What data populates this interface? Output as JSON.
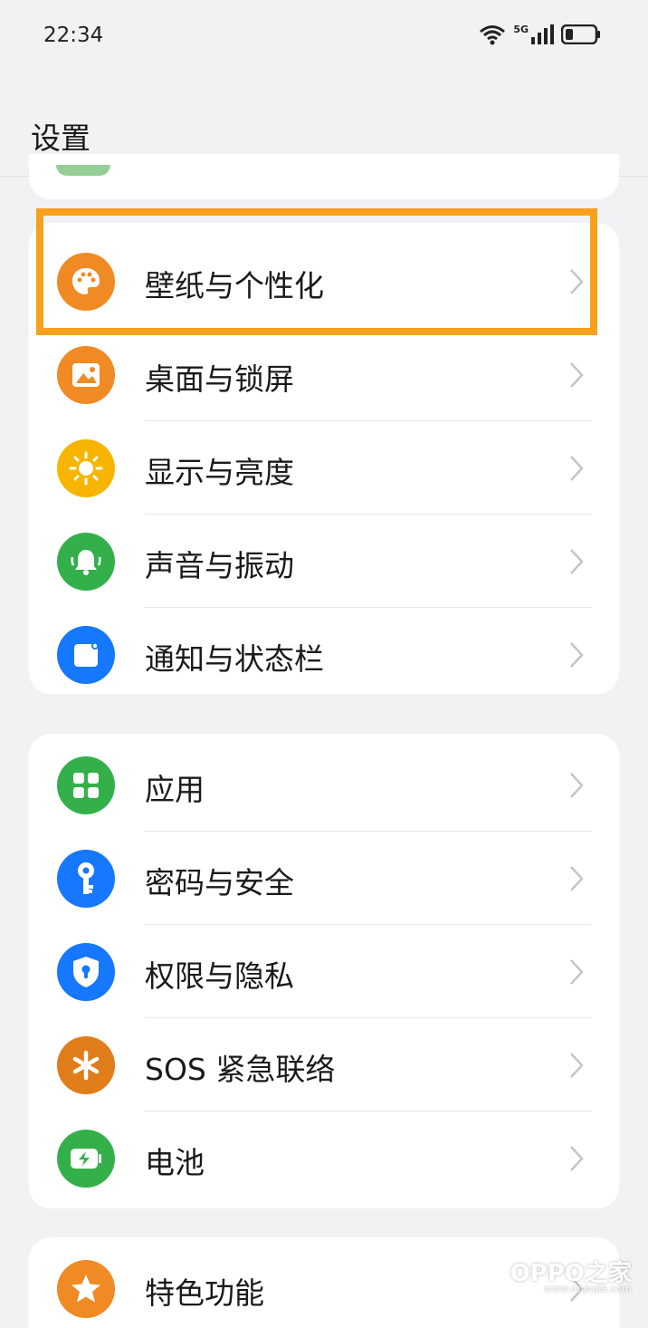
{
  "status_bar": {
    "time": "22:34",
    "network": "5G"
  },
  "header": {
    "title": "设置"
  },
  "card1": [
    {
      "label": "壁纸与个性化",
      "icon": "palette-icon",
      "color": "#f08a24"
    },
    {
      "label": "桌面与锁屏",
      "icon": "image-icon",
      "color": "#f08a24"
    },
    {
      "label": "显示与亮度",
      "icon": "sun-icon",
      "color": "#f7b500"
    },
    {
      "label": "声音与振动",
      "icon": "bell-icon",
      "color": "#34b04a"
    },
    {
      "label": "通知与状态栏",
      "icon": "notification-icon",
      "color": "#1677ff"
    }
  ],
  "card2": [
    {
      "label": "应用",
      "icon": "apps-grid-icon",
      "color": "#34b04a"
    },
    {
      "label": "密码与安全",
      "icon": "key-icon",
      "color": "#1677ff"
    },
    {
      "label": "权限与隐私",
      "icon": "shield-lock-icon",
      "color": "#1677ff"
    },
    {
      "label": "SOS 紧急联络",
      "icon": "asterisk-icon",
      "color": "#e07d1a"
    },
    {
      "label": "电池",
      "icon": "battery-icon",
      "color": "#34b04a"
    }
  ],
  "card3": [
    {
      "label": "特色功能",
      "icon": "star-icon",
      "color": "#f08a24"
    }
  ],
  "highlight_color": "#f7a01c",
  "watermark": {
    "brand": "OPPO之家",
    "url": "www.oppojia.com"
  }
}
